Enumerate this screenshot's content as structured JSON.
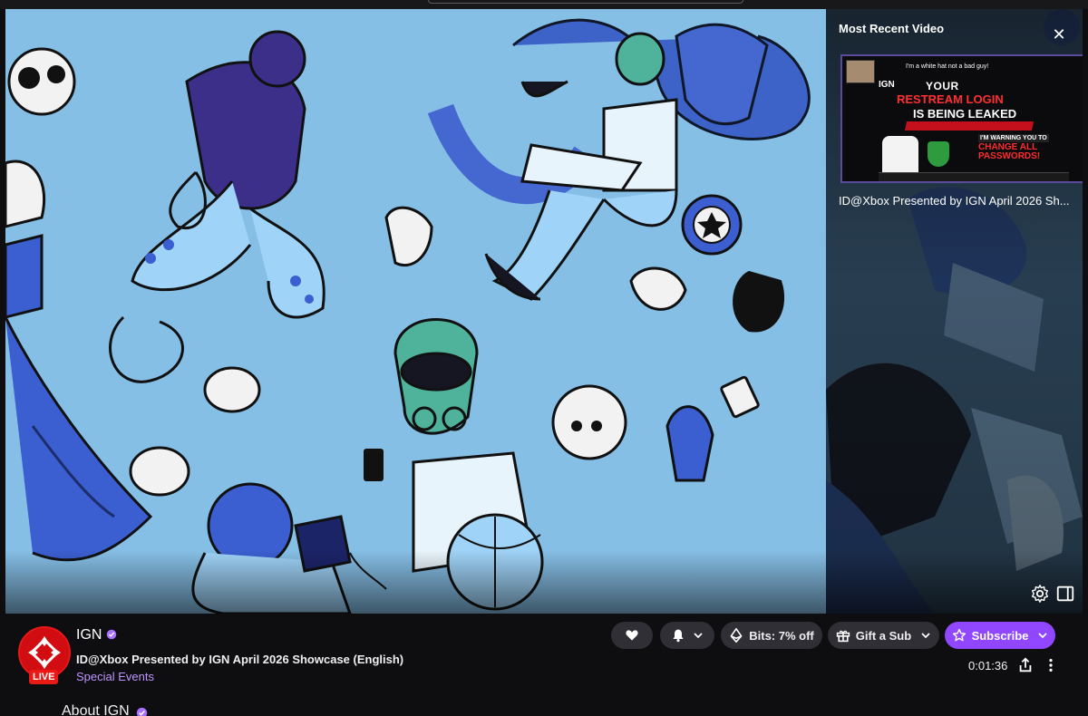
{
  "recent_video": {
    "panel_title": "Most Recent Video",
    "close_label": "✕",
    "thumbnail": {
      "top_text": "I'm a white hat not a bad guy!",
      "brand": "IGN",
      "line1": "YOUR",
      "line2": "RESTREAM LOGIN",
      "line3": "IS BEING LEAKED",
      "line4": "I'M WARNING YOU TO",
      "line5": "CHANGE ALL PASSWORDS!"
    },
    "caption": "ID@Xbox Presented by IGN April 2026 Sh..."
  },
  "channel": {
    "name": "IGN",
    "live_label": "LIVE",
    "stream_title": "ID@Xbox Presented by IGN April 2026 Showcase (English)",
    "category": "Special Events"
  },
  "actions": {
    "bits_label": "Bits: 7% off",
    "gift_label": "Gift a Sub",
    "subscribe_label": "Subscribe"
  },
  "stream_timer": "0:01:36",
  "about_heading": "About IGN",
  "colors": {
    "accent": "#9147ff",
    "live": "#e91916",
    "category": "#bf94ff",
    "background": "#0e0e10"
  },
  "icons": [
    "heart-icon",
    "bell-icon",
    "chevron-down-icon",
    "bits-icon",
    "gift-icon",
    "star-icon",
    "settings-icon",
    "theater-mode-icon",
    "share-icon",
    "more-icon",
    "verified-icon",
    "close-icon"
  ]
}
